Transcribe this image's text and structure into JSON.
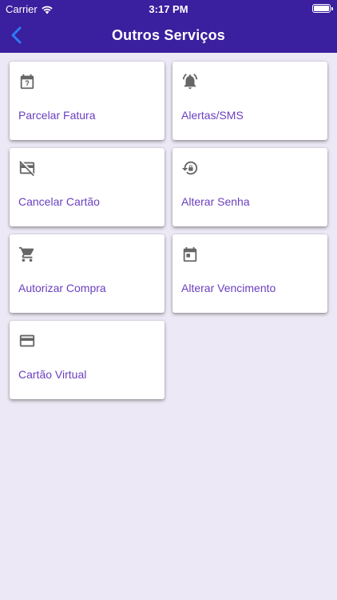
{
  "status_bar": {
    "carrier": "Carrier",
    "time": "3:17 PM"
  },
  "nav": {
    "title": "Outros Serviços",
    "back_icon": "chevron-left-icon"
  },
  "services": [
    {
      "label": "Parcelar Fatura",
      "icon": "calendar-question-icon"
    },
    {
      "label": "Alertas/SMS",
      "icon": "bell-ringing-icon"
    },
    {
      "label": "Cancelar Cartão",
      "icon": "card-off-icon"
    },
    {
      "label": "Alterar Senha",
      "icon": "lock-reset-icon"
    },
    {
      "label": "Autorizar Compra",
      "icon": "cart-icon"
    },
    {
      "label": "Alterar Vencimento",
      "icon": "calendar-icon"
    },
    {
      "label": "Cartão Virtual",
      "icon": "credit-card-icon"
    }
  ],
  "colors": {
    "primary": "#3a1f9e",
    "accent": "#6a3fbf",
    "background": "#ece8f5"
  }
}
